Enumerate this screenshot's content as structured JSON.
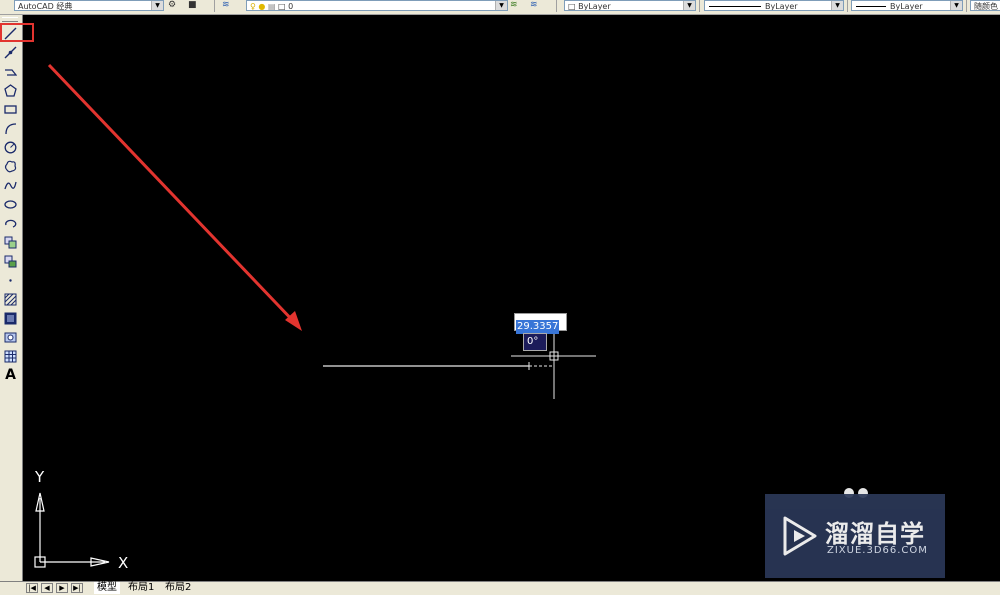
{
  "toolbar": {
    "workspace": "AutoCAD 经典",
    "layer": "0",
    "color": "ByLayer",
    "linetype": "ByLayer",
    "lineweight": "ByLayer",
    "plotstyle": "随颜色"
  },
  "left_toolbar": {
    "tools": [
      "line-icon",
      "construction-line-icon",
      "polyline-icon",
      "polygon-icon",
      "rectangle-icon",
      "arc-icon",
      "circle-icon",
      "revision-cloud-icon",
      "spline-icon",
      "ellipse-icon",
      "ellipse-arc-icon",
      "insert-block-icon",
      "make-block-icon",
      "point-icon",
      "hatch-icon",
      "gradient-icon",
      "region-icon",
      "table-icon",
      "multiline-text-icon"
    ],
    "text_tool_label": "A"
  },
  "canvas": {
    "dynamic_length": "29.3357",
    "dynamic_angle": "0°",
    "ucs_x": "X",
    "ucs_y": "Y",
    "annotation_color": "#e2342f"
  },
  "watermark": {
    "title": "溜溜自学",
    "subtitle": "ZIXUE.3D66.COM"
  },
  "tabs": {
    "model": "模型",
    "layout1": "布局1",
    "layout2": "布局2"
  }
}
